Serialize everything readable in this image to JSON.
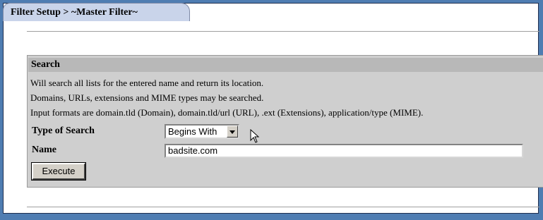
{
  "tab": {
    "title": "Filter Setup > ~Master Filter~"
  },
  "search_panel": {
    "heading": "Search",
    "info_lines": [
      "Will search all lists for the entered name and return its location.",
      "Domains, URLs, extensions and MIME types may be searched.",
      "Input formats are domain.tld (Domain), domain.tld/url (URL), .ext (Extensions), application/type (MIME)."
    ],
    "type_of_search": {
      "label": "Type of Search",
      "selected": "Begins With"
    },
    "name": {
      "label": "Name",
      "value": "badsite.com"
    },
    "execute_label": "Execute"
  }
}
